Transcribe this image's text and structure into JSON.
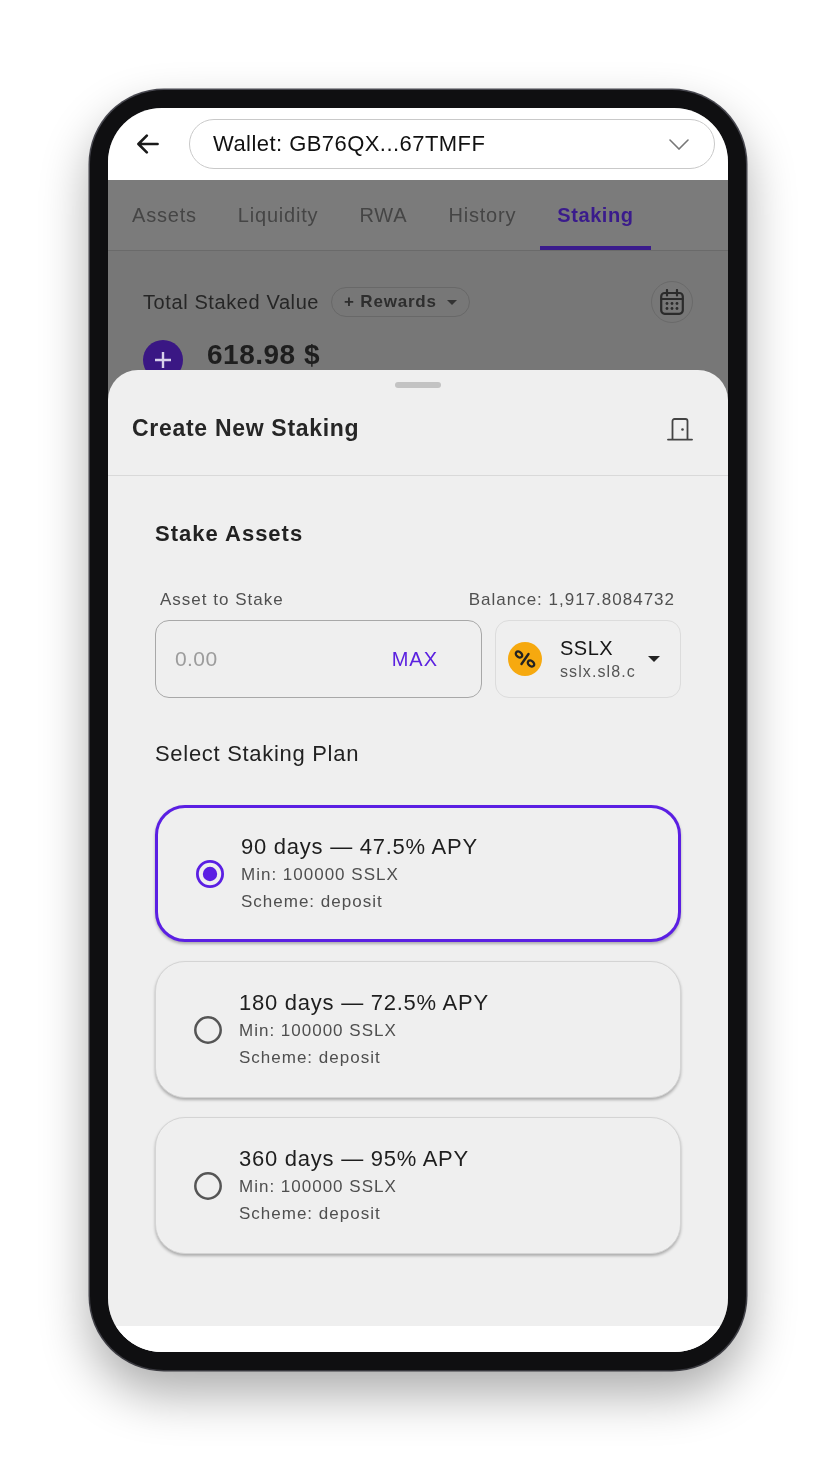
{
  "top_bar": {
    "wallet_selector": {
      "value": "Wallet: GB76QX...67TMFF"
    }
  },
  "tabs": [
    {
      "label": "Assets",
      "selected": false
    },
    {
      "label": "Liquidity",
      "selected": false
    },
    {
      "label": "RWA",
      "selected": false
    },
    {
      "label": "History",
      "selected": false
    },
    {
      "label": "Staking",
      "selected": true
    }
  ],
  "summary": {
    "title": "Total Staked Value",
    "filter_chip": "+ Rewards",
    "amount": "618.98 $"
  },
  "sheet": {
    "title": "Create New Staking",
    "section_title": "Stake Assets",
    "amount_field": {
      "label": "Asset to Stake",
      "placeholder": "0.00",
      "max_button": "MAX"
    },
    "balance": "Balance: 1,917.8084732",
    "asset_selector": {
      "symbol": "SSLX",
      "domain": "sslx.sl8.c"
    },
    "plans_title": "Select Staking Plan",
    "plans": [
      {
        "title": "90 days — 47.5% APY",
        "min": "Min: 100000 SSLX",
        "scheme": "Scheme: deposit",
        "selected": true
      },
      {
        "title": "180 days — 72.5% APY",
        "min": "Min: 100000 SSLX",
        "scheme": "Scheme: deposit",
        "selected": false
      },
      {
        "title": "360 days — 95% APY",
        "min": "Min: 100000 SSLX",
        "scheme": "Scheme: deposit",
        "selected": false
      }
    ]
  }
}
